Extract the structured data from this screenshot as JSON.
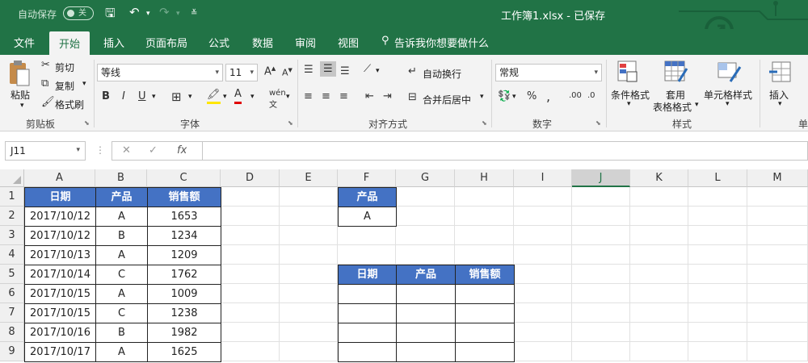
{
  "titlebar": {
    "autosave_label": "自动保存",
    "autosave_state": "关",
    "doc_title": "工作簿1.xlsx  -  已保存"
  },
  "tabs": [
    "文件",
    "开始",
    "插入",
    "页面布局",
    "公式",
    "数据",
    "审阅",
    "视图"
  ],
  "tell_me": "告诉我你想要做什么",
  "ribbon": {
    "clipboard": {
      "paste": "粘贴",
      "cut": "剪切",
      "copy": "复制",
      "format_painter": "格式刷",
      "label": "剪贴板"
    },
    "font": {
      "name": "等线",
      "size": "11",
      "label": "字体"
    },
    "alignment": {
      "wrap": "自动换行",
      "merge": "合并后居中",
      "label": "对齐方式"
    },
    "number": {
      "format": "常规",
      "label": "数字"
    },
    "styles": {
      "cond": "条件格式",
      "table1": "套用",
      "table2": "表格格式",
      "cell": "单元格样式",
      "label": "样式"
    },
    "cells": {
      "insert": "插入",
      "label": "单"
    }
  },
  "formula": {
    "namebox": "J11",
    "value": ""
  },
  "columns": [
    "A",
    "B",
    "C",
    "D",
    "E",
    "F",
    "G",
    "H",
    "I",
    "J",
    "K",
    "L",
    "M"
  ],
  "rows": [
    "1",
    "2",
    "3",
    "4",
    "5",
    "6",
    "7",
    "8",
    "9"
  ],
  "table1": {
    "headers": [
      "日期",
      "产品",
      "销售额"
    ],
    "rows": [
      [
        "2017/10/12",
        "A",
        "1653"
      ],
      [
        "2017/10/12",
        "B",
        "1234"
      ],
      [
        "2017/10/13",
        "A",
        "1209"
      ],
      [
        "2017/10/14",
        "C",
        "1762"
      ],
      [
        "2017/10/15",
        "A",
        "1009"
      ],
      [
        "2017/10/15",
        "C",
        "1238"
      ],
      [
        "2017/10/16",
        "B",
        "1982"
      ],
      [
        "2017/10/17",
        "A",
        "1625"
      ]
    ]
  },
  "criteria": {
    "header": "产品",
    "value": "A"
  },
  "result": {
    "headers": [
      "日期",
      "产品",
      "销售额"
    ]
  }
}
